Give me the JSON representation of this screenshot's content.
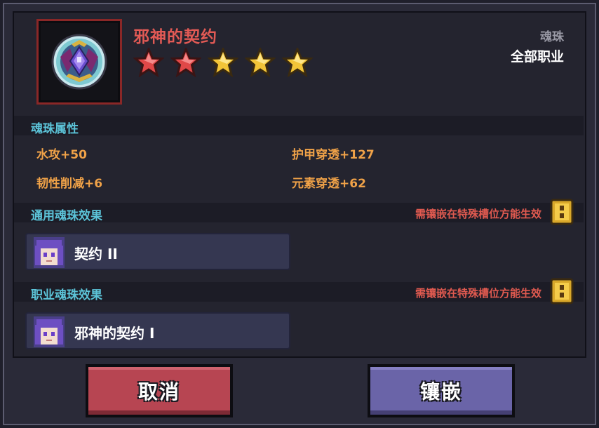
{
  "item": {
    "name": "邪神的契约",
    "type": "魂珠",
    "class": "全部职业",
    "stars": [
      {
        "color": "red"
      },
      {
        "color": "red"
      },
      {
        "color": "yellow"
      },
      {
        "color": "yellow"
      },
      {
        "color": "yellow"
      }
    ],
    "icon": "soul-orb-icon"
  },
  "attributes": {
    "title": "魂珠属性",
    "stats": [
      "水攻+50",
      "护甲穿透+127",
      "韧性削减+6",
      "元素穿透+62"
    ]
  },
  "general_effect": {
    "title": "通用魂珠效果",
    "note": "需镶嵌在特殊槽位方能生效",
    "effect_label": "契约 II"
  },
  "class_effect": {
    "title": "职业魂珠效果",
    "note": "需镶嵌在特殊槽位方能生效",
    "effect_label": "邪神的契约 I"
  },
  "buttons": {
    "cancel": "取消",
    "inlay": "镶嵌"
  },
  "colors": {
    "accent_red": "#e25a55",
    "section_title": "#5cc4d9",
    "stat_text": "#f0a248",
    "cancel_button": "#b74552",
    "inlay_button": "#6a64a8"
  }
}
